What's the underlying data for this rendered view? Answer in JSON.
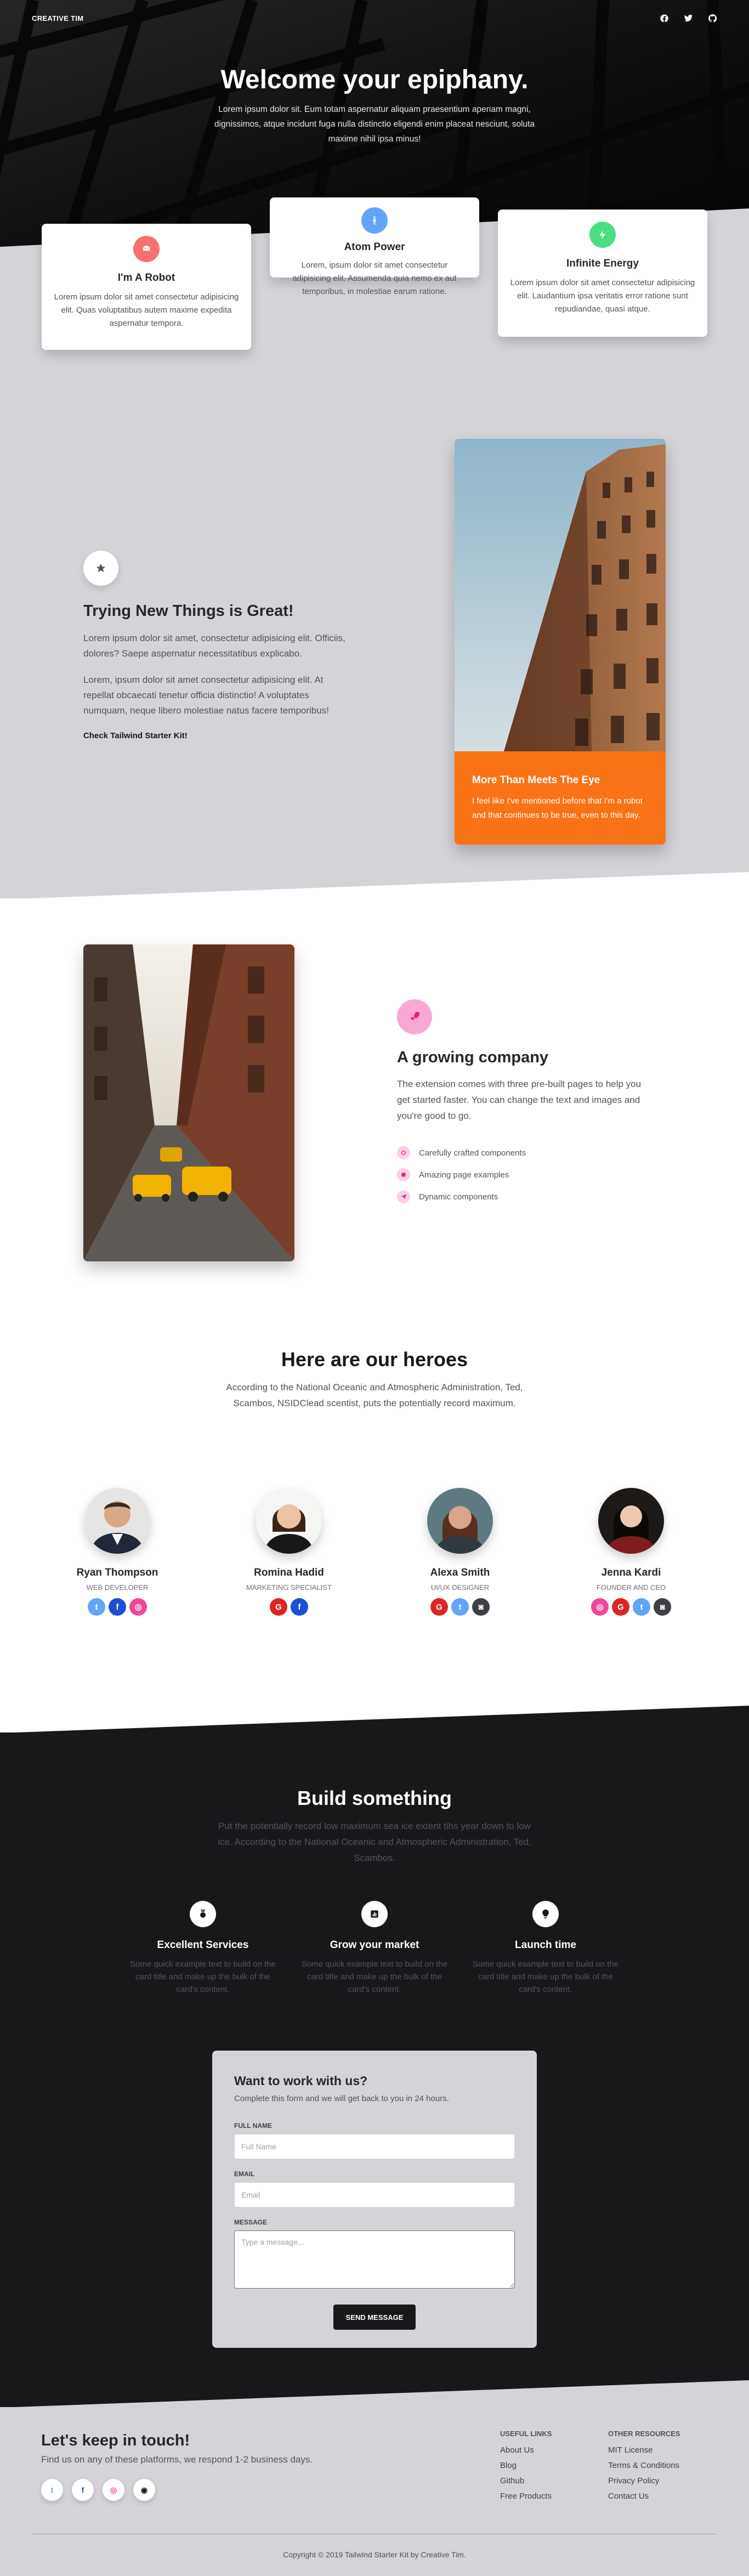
{
  "nav": {
    "brand": "CREATIVE TIM",
    "icons": [
      "facebook-icon",
      "twitter-icon",
      "github-icon"
    ]
  },
  "hero": {
    "title": "Welcome your epiphany.",
    "text": "Lorem ipsum dolor sit. Eum totam aspernatur aliquam praesentium aperiam magni, dignissimos, atque incidunt fuga nulla distinctio eligendi enim placeat nesciunt, soluta maxime nihil ipsa minus!"
  },
  "cards": [
    {
      "title": "I'm A Robot",
      "text": "Lorem ipsum dolor sit amet consectetur adipisicing elit. Quas voluptatibus autem maxime expedita aspernatur tempora.",
      "icon": "robot-icon",
      "color": "#f87171"
    },
    {
      "title": "Atom Power",
      "text": "Lorem, ipsum dolor sit amet consectetur adipisicing elit. Assumenda quia nemo ex aut temporibus, in molestiae earum ratione.",
      "icon": "atom-icon",
      "color": "#60a5fa"
    },
    {
      "title": "Infinite Energy",
      "text": "Lorem ipsum dolor sit amet consectetur adipisicing elit. Laudantium ipsa veritatis error ratione sunt repudiandae, quasi atque.",
      "icon": "lightning-icon",
      "color": "#4ade80"
    }
  ],
  "section2": {
    "title": "Trying New Things is Great!",
    "p1": "Lorem ipsum dolor sit amet, consectetur adipisicing elit. Officiis, dolores? Saepe aspernatur necessitatibus explicabo.",
    "p2": "Lorem, ipsum dolor sit amet consectetur adipisicing elit. At repellat obcaecati tenetur officia distinctio! A voluptates numquam, neque libero molestiae natus facere temporibus!",
    "link": "Check Tailwind Starter Kit!",
    "card_title": "More Than Meets The Eye",
    "card_text": "I feel like I've mentioned before that I'm a robot and that continues to be true, even to this day."
  },
  "section3": {
    "title": "A growing company",
    "text": "The extension comes with three pre-built pages to help you get started faster. You can change the text and images and you're good to go.",
    "items": [
      "Carefully crafted components",
      "Amazing page examples",
      "Dynamic components"
    ]
  },
  "team": {
    "title": "Here are our heroes",
    "subtitle": "According to the National Oceanic and Atmospheric Administration, Ted, Scambos, NSIDClead scentist, puts the potentially record maximum.",
    "members": [
      {
        "name": "Ryan Thompson",
        "role": "WEB DEVELOPER",
        "socials": [
          "twitter",
          "facebook",
          "dribbble"
        ]
      },
      {
        "name": "Romina Hadid",
        "role": "MARKETING SPECIALIST",
        "socials": [
          "google",
          "facebook"
        ]
      },
      {
        "name": "Alexa Smith",
        "role": "UI/UX DESIGNER",
        "socials": [
          "google",
          "twitter",
          "instagram"
        ]
      },
      {
        "name": "Jenna Kardi",
        "role": "FOUNDER AND CEO",
        "socials": [
          "dribbble",
          "google",
          "twitter",
          "instagram"
        ]
      }
    ]
  },
  "build": {
    "title": "Build something",
    "subtitle": "Put the potentially record low maximum sea ice extent tihs year down to low ice. According to the National Oceanic and Atmospheric Administration, Ted, Scambos.",
    "features": [
      {
        "title": "Excellent Services",
        "text": "Some quick example text to build on the card title and make up the bulk of the card's content.",
        "icon": "medal-icon"
      },
      {
        "title": "Grow your market",
        "text": "Some quick example text to build on the card title and make up the bulk of the card's content.",
        "icon": "poll-icon"
      },
      {
        "title": "Launch time",
        "text": "Some quick example text to build on the card title and make up the bulk of the card's content.",
        "icon": "lightbulb-icon"
      }
    ]
  },
  "form": {
    "title": "Want to work with us?",
    "subtitle": "Complete this form and we will get back to you in 24 hours.",
    "name_label": "FULL NAME",
    "name_placeholder": "Full Name",
    "email_label": "EMAIL",
    "email_placeholder": "Email",
    "message_label": "MESSAGE",
    "message_placeholder": "Type a message...",
    "button": "SEND MESSAGE"
  },
  "footer": {
    "title": "Let's keep in touch!",
    "subtitle": "Find us on any of these platforms, we respond 1-2 business days.",
    "useful_title": "USEFUL LINKS",
    "useful_links": [
      "About Us",
      "Blog",
      "Github",
      "Free Products"
    ],
    "other_title": "OTHER RESOURCES",
    "other_links": [
      "MIT License",
      "Terms & Conditions",
      "Privacy Policy",
      "Contact Us"
    ],
    "copyright": "Copyright © 2019 Tailwind Starter Kit by Creative Tim."
  }
}
